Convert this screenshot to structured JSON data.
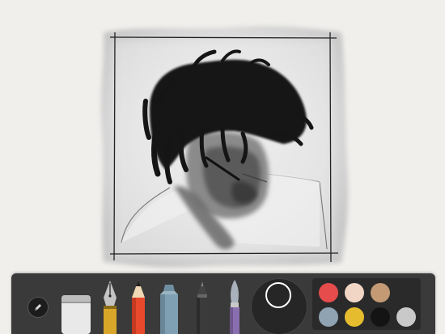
{
  "tools": [
    {
      "name": "eraser",
      "icon": "eraser-icon"
    },
    {
      "name": "fountain-pen",
      "icon": "fountain-pen-icon"
    },
    {
      "name": "pencil",
      "icon": "pencil-icon"
    },
    {
      "name": "marker",
      "icon": "marker-icon"
    },
    {
      "name": "outline-pen",
      "icon": "outline-pen-icon"
    },
    {
      "name": "watercolor-brush",
      "icon": "watercolor-brush-icon"
    }
  ],
  "current_color": "#262626",
  "palette": [
    {
      "name": "coral-red",
      "color": "#e64c4c"
    },
    {
      "name": "blush",
      "color": "#f1d6c6"
    },
    {
      "name": "tan",
      "color": "#c39a73"
    },
    {
      "name": "slate-blue",
      "color": "#8fa3b2"
    },
    {
      "name": "mustard",
      "color": "#e6bc2f"
    },
    {
      "name": "black",
      "color": "#141414"
    },
    {
      "name": "light-gray",
      "color": "#c9c9c9"
    }
  ]
}
